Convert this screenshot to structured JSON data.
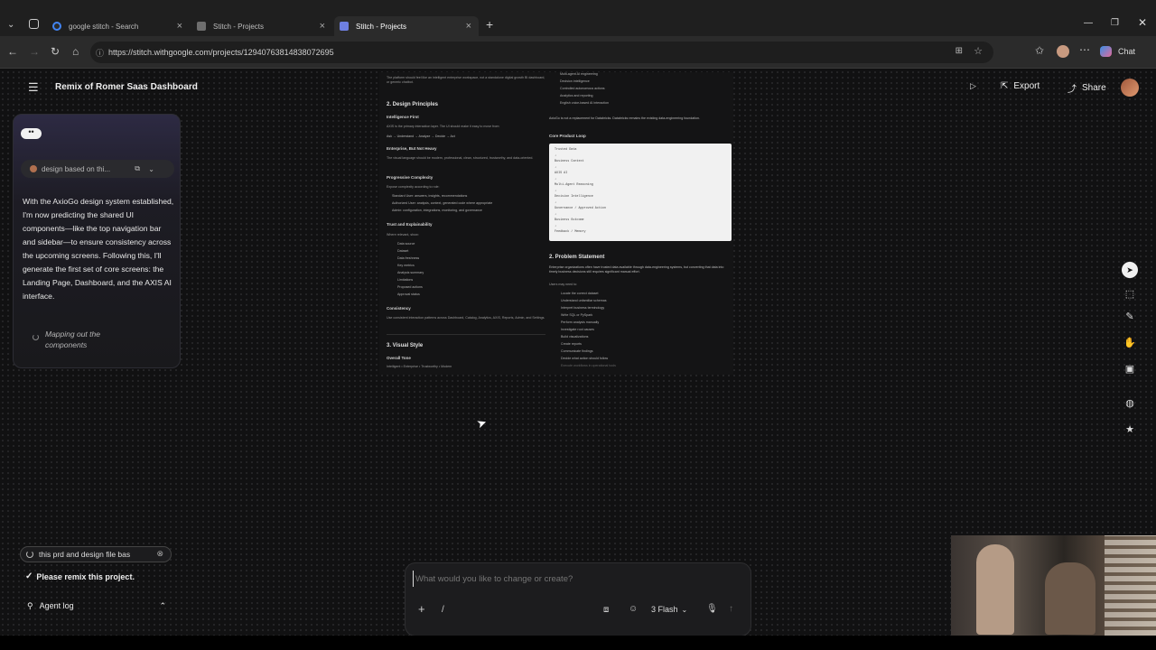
{
  "browser": {
    "tabs": [
      {
        "label": "google stitch - Search",
        "icon": "google-icon"
      },
      {
        "label": "Stitch - Projects",
        "icon": "stitch-icon"
      },
      {
        "label": "Stitch - Projects",
        "icon": "stitch-icon",
        "active": true
      }
    ],
    "url": "https://stitch.withgoogle.com/projects/12940763814838072695",
    "chat_label": "Chat"
  },
  "app": {
    "project_title": "Remix of Romer Saas Dashboard",
    "export_label": "Export",
    "share_label": "Share"
  },
  "chat": {
    "context_chip": "design based on thi...",
    "message": "With the AxioGo design system established, I'm now predicting the shared UI components—like the top navigation bar and sidebar—to ensure consistency across the upcoming screens. Following this, I'll generate the first set of core screens: the Landing Page, Dashboard, and the AXIS AI interface.",
    "status": "Mapping out the components"
  },
  "tasks": {
    "running": "this prd and design file bas",
    "done": "Please remix this project.",
    "agent_log": "Agent log"
  },
  "doc": {
    "left": {
      "intro": "The platform should feel like an intelligent enterprise workspace, not a standalone digital growth BI dashboard, or generic chatbot.",
      "h2": "2. Design Principles",
      "p1_title": "Intelligence First",
      "p1_text": "AXIS is the primary interaction layer. The UI should make it easy to move from:",
      "p1_flow": "Ask → Understand → Analyze → Decide → Act",
      "p2_title": "Enterprise, But Not Heavy",
      "p2_text": "The visual language should be modern, professional, clean, structured, trustworthy, and data-oriented.",
      "p3_title": "Progressive Complexity",
      "p3_text": "Expose complexity according to role:",
      "p3_items": [
        "Standard User: answers, insights, recommendations",
        "Authorized User: analysis, context, generated code where appropriate",
        "Admin: configuration, integrations, monitoring, and governance"
      ],
      "p4_title": "Trust and Explainability",
      "p4_text": "Where relevant, show:",
      "p4_items": [
        "Data source",
        "Dataset",
        "Data freshness",
        "Key metrics",
        "Analysis summary",
        "Limitations",
        "Proposed actions",
        "Approval status"
      ],
      "p5_title": "Consistency",
      "p5_text": "Use consistent interaction patterns across Dashboard, Catalog, Analytics, AXIS, Reports, Admin, and Settings.",
      "h3": "3. Visual Style",
      "p6_title": "Overall Tone",
      "p6_text": "Intelligent • Enterprise • Trustworthy • Modern"
    },
    "right": {
      "top_items": [
        "Multi-agent AI engineering",
        "Decision intelligence",
        "Controlled autonomous actions",
        "Analytics and reporting",
        "English voice-based AI interaction"
      ],
      "note": "AxioGo is not a replacement for Databricks. Databricks remains the existing data-engineering foundation.",
      "loop_title": "Core Product Loop",
      "loop_lines": [
        "Trusted Data",
        "↓",
        "Business Context",
        "↓",
        "AXIS AI",
        "↓",
        "Multi-Agent Reasoning",
        "↓",
        "Decision Intelligence",
        "↓",
        "Governance / Approved Action",
        "↓",
        "Business Outcome",
        "↓",
        "Feedback / Memory"
      ],
      "h2": "2. Problem Statement",
      "ps_text": "Enterprise organizations often have trusted data available through data-engineering systems, but converting that data into timely business decisions still requires significant manual effort.",
      "ps_sub": "Users may need to:",
      "ps_items": [
        "Locate the correct dataset",
        "Understand unfamiliar schemas",
        "Interpret business terminology",
        "Write SQL or PySpark",
        "Perform analysis manually",
        "Investigate root causes",
        "Build visualizations",
        "Create reports",
        "Communicate findings",
        "Decide what action should follow",
        "Execute workflows in operational tools"
      ]
    }
  },
  "prompt": {
    "placeholder": "What would you like to change or create?",
    "slash": "/",
    "model": "3 Flash"
  }
}
